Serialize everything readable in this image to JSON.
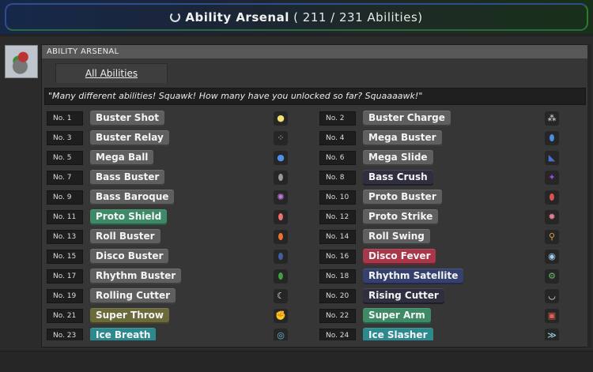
{
  "header": {
    "title": "Ability Arsenal",
    "count": "( 211 / 231 Abilities)",
    "icon": "power-icon"
  },
  "panel": {
    "heading": "ABILITY ARSENAL",
    "tab_label": "All Abilities",
    "quote": "\"Many different abilities! Squawk! How many have you unlocked so far? Squaaaawk!\""
  },
  "colors": {
    "default": "#5f5f5f",
    "green": "#3e8a67",
    "red": "#a8374a",
    "navy": "#36406e",
    "olive": "#6a6a3a",
    "teal": "#2c8a8f",
    "dark": "#2f2f40"
  },
  "abilities": [
    {
      "num": "No. 1",
      "name": "Buster Shot",
      "style": "default",
      "icon": "pellet-icon",
      "glyph": "●",
      "gcolor": "#f3e070"
    },
    {
      "num": "No. 2",
      "name": "Buster Charge",
      "style": "default",
      "icon": "charge-ring-icon",
      "glyph": "⁂",
      "gcolor": "#e8e8e8"
    },
    {
      "num": "No. 3",
      "name": "Buster Relay",
      "style": "default",
      "icon": "relay-dots-icon",
      "glyph": "⁘",
      "gcolor": "#d8d8d8"
    },
    {
      "num": "No. 4",
      "name": "Mega Buster",
      "style": "default",
      "icon": "blue-capsule-icon",
      "glyph": "⬮",
      "gcolor": "#4a8ee0"
    },
    {
      "num": "No. 5",
      "name": "Mega Ball",
      "style": "default",
      "icon": "ball-icon",
      "glyph": "●",
      "gcolor": "#4f8fe8"
    },
    {
      "num": "No. 6",
      "name": "Mega Slide",
      "style": "default",
      "icon": "slide-icon",
      "glyph": "◣",
      "gcolor": "#4a6fd0"
    },
    {
      "num": "No. 7",
      "name": "Bass Buster",
      "style": "default",
      "icon": "grey-capsule-icon",
      "glyph": "⬮",
      "gcolor": "#9a9a9a"
    },
    {
      "num": "No. 8",
      "name": "Bass Crush",
      "style": "dark",
      "icon": "purple-crush-icon",
      "glyph": "✦",
      "gcolor": "#9a4ae0"
    },
    {
      "num": "No. 9",
      "name": "Bass Baroque",
      "style": "default",
      "icon": "baroque-icon",
      "glyph": "✺",
      "gcolor": "#c07ae0"
    },
    {
      "num": "No. 10",
      "name": "Proto Buster",
      "style": "default",
      "icon": "red-capsule-icon",
      "glyph": "⬮",
      "gcolor": "#e05050"
    },
    {
      "num": "No. 11",
      "name": "Proto Shield",
      "style": "green",
      "icon": "shield-icon",
      "glyph": "⬮",
      "gcolor": "#f07070"
    },
    {
      "num": "No. 12",
      "name": "Proto Strike",
      "style": "default",
      "icon": "strike-icon",
      "glyph": "✹",
      "gcolor": "#e08090"
    },
    {
      "num": "No. 13",
      "name": "Roll Buster",
      "style": "default",
      "icon": "orange-capsule-icon",
      "glyph": "⬮",
      "gcolor": "#f07030"
    },
    {
      "num": "No. 14",
      "name": "Roll Swing",
      "style": "default",
      "icon": "broom-icon",
      "glyph": "⚲",
      "gcolor": "#e0a040"
    },
    {
      "num": "No. 15",
      "name": "Disco Buster",
      "style": "default",
      "icon": "navy-capsule-icon",
      "glyph": "⬮",
      "gcolor": "#4060a0"
    },
    {
      "num": "No. 16",
      "name": "Disco Fever",
      "style": "red",
      "icon": "disco-ball-icon",
      "glyph": "◉",
      "gcolor": "#a0d0f0"
    },
    {
      "num": "No. 17",
      "name": "Rhythm Buster",
      "style": "default",
      "icon": "green-capsule-icon",
      "glyph": "⬮",
      "gcolor": "#40a040"
    },
    {
      "num": "No. 18",
      "name": "Rhythm Satellite",
      "style": "navy",
      "icon": "satellite-icon",
      "glyph": "⚙",
      "gcolor": "#60c060"
    },
    {
      "num": "No. 19",
      "name": "Rolling Cutter",
      "style": "default",
      "icon": "cutter-icon",
      "glyph": "☾",
      "gcolor": "#f0f0f0"
    },
    {
      "num": "No. 20",
      "name": "Rising Cutter",
      "style": "dark",
      "icon": "rising-cutter-icon",
      "glyph": "◡",
      "gcolor": "#f0f0f0"
    },
    {
      "num": "No. 21",
      "name": "Super Throw",
      "style": "olive",
      "icon": "throw-icon",
      "glyph": "✊",
      "gcolor": "#e04030"
    },
    {
      "num": "No. 22",
      "name": "Super Arm",
      "style": "green",
      "icon": "arm-block-icon",
      "glyph": "▣",
      "gcolor": "#e06050"
    },
    {
      "num": "No. 23",
      "name": "Ice Breath",
      "style": "teal",
      "icon": "ice-breath-icon",
      "glyph": "◎",
      "gcolor": "#70c0e0"
    },
    {
      "num": "No. 24",
      "name": "Ice Slasher",
      "style": "teal",
      "icon": "ice-slasher-icon",
      "glyph": "≫",
      "gcolor": "#a0e0f0"
    }
  ]
}
